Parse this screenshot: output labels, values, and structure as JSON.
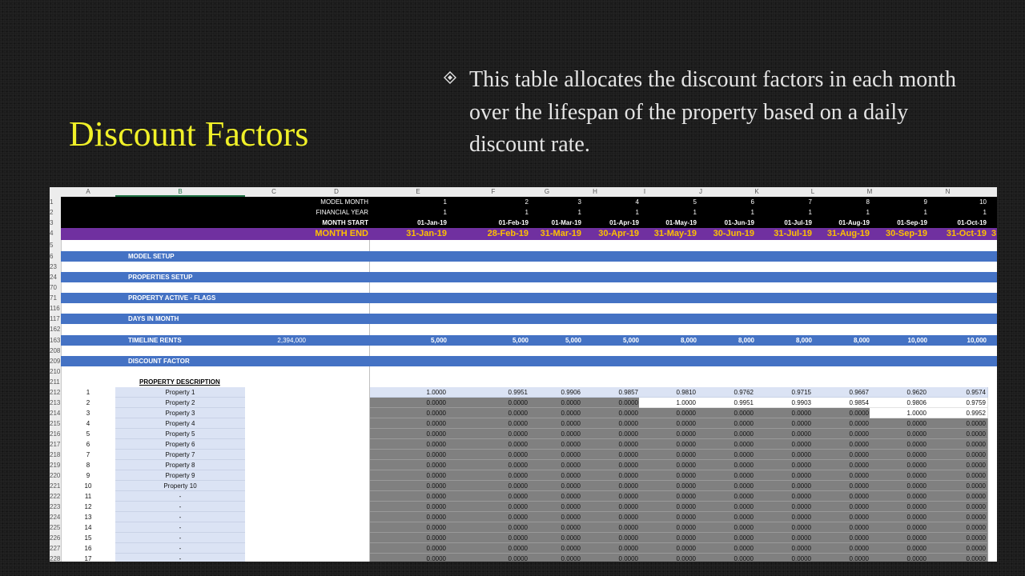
{
  "slide": {
    "title": "Discount Factors",
    "bullet": "This table allocates the discount factors in each month over the lifespan of the property based on a daily discount rate.",
    "bullet_icon": "diamond-bullet-icon",
    "colors": {
      "title": "#f0f028",
      "text": "#e4e4e4",
      "purple": "#7030a0",
      "blue": "#4472c4",
      "month_end": "#ffc000",
      "grey": "#808080",
      "light": "#dbe3f4"
    }
  },
  "sheet": {
    "col_letters": [
      "A",
      "B",
      "C",
      "D",
      "E",
      "F",
      "G",
      "H",
      "I",
      "J",
      "K",
      "L",
      "M",
      "N"
    ],
    "header_rows": {
      "model_month_label": "MODEL MONTH",
      "financial_year_label": "FINANCIAL YEAR",
      "month_start_label": "MONTH START",
      "month_end_label": "MONTH END",
      "model_month": [
        "1",
        "2",
        "3",
        "4",
        "5",
        "6",
        "7",
        "8",
        "9",
        "10"
      ],
      "financial_year": [
        "1",
        "1",
        "1",
        "1",
        "1",
        "1",
        "1",
        "1",
        "1",
        "1"
      ],
      "month_start": [
        "01-Jan-19",
        "01-Feb-19",
        "01-Mar-19",
        "01-Apr-19",
        "01-May-19",
        "01-Jun-19",
        "01-Jul-19",
        "01-Aug-19",
        "01-Sep-19",
        "01-Oct-19"
      ],
      "month_end": [
        "31-Jan-19",
        "28-Feb-19",
        "31-Mar-19",
        "30-Apr-19",
        "31-May-19",
        "30-Jun-19",
        "31-Jul-19",
        "31-Aug-19",
        "30-Sep-19",
        "31-Oct-19"
      ],
      "month_end_overflow": "3"
    },
    "row_numbers": [
      "1",
      "2",
      "3",
      "4",
      "5",
      "6",
      "23",
      "24",
      "70",
      "71",
      "116",
      "117",
      "162",
      "163",
      "208",
      "209",
      "210",
      "211",
      "212",
      "213",
      "214",
      "215",
      "216",
      "217",
      "218",
      "219",
      "220",
      "221",
      "222",
      "223",
      "224",
      "225",
      "226",
      "227",
      "228"
    ],
    "sections": {
      "model_setup": "MODEL SETUP",
      "properties_setup": "PROPERTIES SETUP",
      "property_active_flags": "PROPERTY ACTIVE - FLAGS",
      "days_in_month": "DAYS IN MONTH",
      "timeline_rents": "TIMELINE RENTS",
      "timeline_rents_total": "2,394,000",
      "timeline_rents_values": [
        "5,000",
        "5,000",
        "5,000",
        "5,000",
        "8,000",
        "8,000",
        "8,000",
        "8,000",
        "10,000",
        "10,000"
      ],
      "discount_factor": "DISCOUNT FACTOR"
    },
    "property_description_header": "PROPERTY DESCRIPTION",
    "properties": [
      {
        "idx": "1",
        "name": "Property 1",
        "values": [
          "1.0000",
          "0.9951",
          "0.9906",
          "0.9857",
          "0.9810",
          "0.9762",
          "0.9715",
          "0.9667",
          "0.9620",
          "0.9574"
        ]
      },
      {
        "idx": "2",
        "name": "Property 2",
        "values": [
          "0.0000",
          "0.0000",
          "0.0000",
          "0.0000",
          "1.0000",
          "0.9951",
          "0.9903",
          "0.9854",
          "0.9806",
          "0.9759"
        ]
      },
      {
        "idx": "3",
        "name": "Property 3",
        "values": [
          "0.0000",
          "0.0000",
          "0.0000",
          "0.0000",
          "0.0000",
          "0.0000",
          "0.0000",
          "0.0000",
          "1.0000",
          "0.9952"
        ]
      },
      {
        "idx": "4",
        "name": "Property 4",
        "values": [
          "0.0000",
          "0.0000",
          "0.0000",
          "0.0000",
          "0.0000",
          "0.0000",
          "0.0000",
          "0.0000",
          "0.0000",
          "0.0000"
        ]
      },
      {
        "idx": "5",
        "name": "Property 5",
        "values": [
          "0.0000",
          "0.0000",
          "0.0000",
          "0.0000",
          "0.0000",
          "0.0000",
          "0.0000",
          "0.0000",
          "0.0000",
          "0.0000"
        ]
      },
      {
        "idx": "6",
        "name": "Property 6",
        "values": [
          "0.0000",
          "0.0000",
          "0.0000",
          "0.0000",
          "0.0000",
          "0.0000",
          "0.0000",
          "0.0000",
          "0.0000",
          "0.0000"
        ]
      },
      {
        "idx": "7",
        "name": "Property 7",
        "values": [
          "0.0000",
          "0.0000",
          "0.0000",
          "0.0000",
          "0.0000",
          "0.0000",
          "0.0000",
          "0.0000",
          "0.0000",
          "0.0000"
        ]
      },
      {
        "idx": "8",
        "name": "Property 8",
        "values": [
          "0.0000",
          "0.0000",
          "0.0000",
          "0.0000",
          "0.0000",
          "0.0000",
          "0.0000",
          "0.0000",
          "0.0000",
          "0.0000"
        ]
      },
      {
        "idx": "9",
        "name": "Property 9",
        "values": [
          "0.0000",
          "0.0000",
          "0.0000",
          "0.0000",
          "0.0000",
          "0.0000",
          "0.0000",
          "0.0000",
          "0.0000",
          "0.0000"
        ]
      },
      {
        "idx": "10",
        "name": "Property 10",
        "values": [
          "0.0000",
          "0.0000",
          "0.0000",
          "0.0000",
          "0.0000",
          "0.0000",
          "0.0000",
          "0.0000",
          "0.0000",
          "0.0000"
        ]
      },
      {
        "idx": "11",
        "name": "-",
        "values": [
          "0.0000",
          "0.0000",
          "0.0000",
          "0.0000",
          "0.0000",
          "0.0000",
          "0.0000",
          "0.0000",
          "0.0000",
          "0.0000"
        ]
      },
      {
        "idx": "12",
        "name": "-",
        "values": [
          "0.0000",
          "0.0000",
          "0.0000",
          "0.0000",
          "0.0000",
          "0.0000",
          "0.0000",
          "0.0000",
          "0.0000",
          "0.0000"
        ]
      },
      {
        "idx": "13",
        "name": "-",
        "values": [
          "0.0000",
          "0.0000",
          "0.0000",
          "0.0000",
          "0.0000",
          "0.0000",
          "0.0000",
          "0.0000",
          "0.0000",
          "0.0000"
        ]
      },
      {
        "idx": "14",
        "name": "-",
        "values": [
          "0.0000",
          "0.0000",
          "0.0000",
          "0.0000",
          "0.0000",
          "0.0000",
          "0.0000",
          "0.0000",
          "0.0000",
          "0.0000"
        ]
      },
      {
        "idx": "15",
        "name": "-",
        "values": [
          "0.0000",
          "0.0000",
          "0.0000",
          "0.0000",
          "0.0000",
          "0.0000",
          "0.0000",
          "0.0000",
          "0.0000",
          "0.0000"
        ]
      },
      {
        "idx": "16",
        "name": "-",
        "values": [
          "0.0000",
          "0.0000",
          "0.0000",
          "0.0000",
          "0.0000",
          "0.0000",
          "0.0000",
          "0.0000",
          "0.0000",
          "0.0000"
        ]
      },
      {
        "idx": "17",
        "name": "-",
        "values": [
          "0.0000",
          "0.0000",
          "0.0000",
          "0.0000",
          "0.0000",
          "0.0000",
          "0.0000",
          "0.0000",
          "0.0000",
          "0.0000"
        ]
      }
    ]
  }
}
